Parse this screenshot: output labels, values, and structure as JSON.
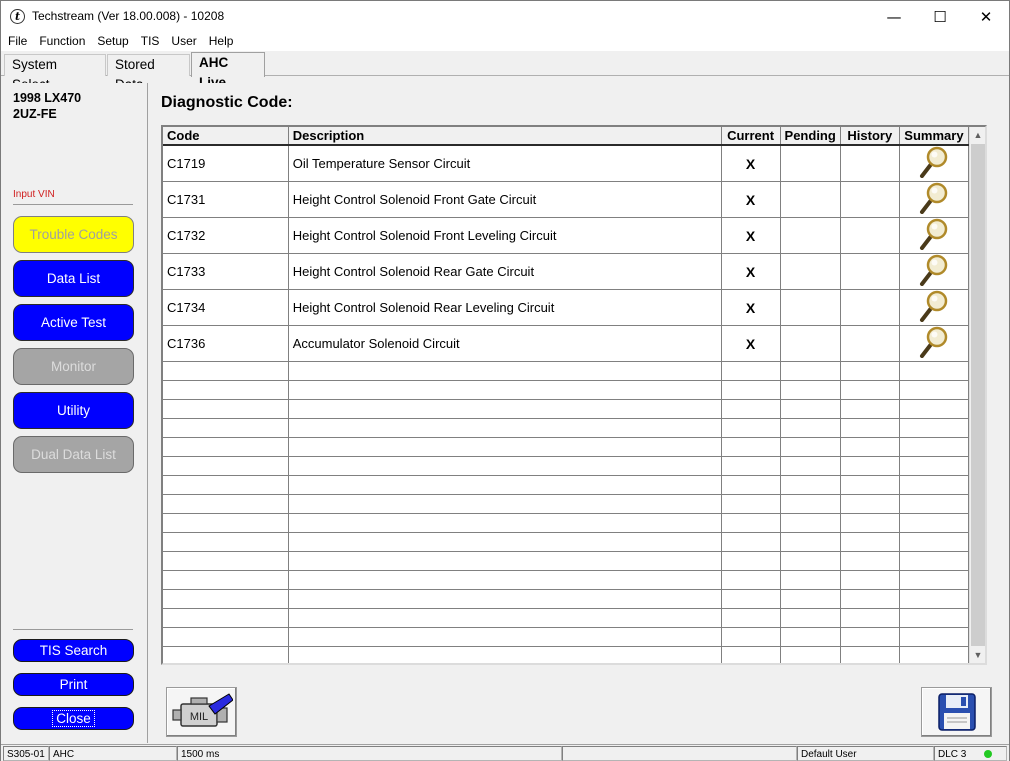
{
  "window": {
    "title": "Techstream (Ver 18.00.008) - 10208",
    "app_icon_glyph": "t",
    "minimize_glyph": "—",
    "maximize_glyph": "☐",
    "close_glyph": "✕"
  },
  "menu": [
    "File",
    "Function",
    "Setup",
    "TIS",
    "User",
    "Help"
  ],
  "tabs": [
    {
      "label": "System Select",
      "active": false
    },
    {
      "label": "Stored Data",
      "active": false
    },
    {
      "label": "AHC Live",
      "active": true
    }
  ],
  "sidebar": {
    "vehicle_line1": "1998 LX470",
    "vehicle_line2": "2UZ-FE",
    "input_vin_label": "Input VIN",
    "buttons": [
      {
        "label": "Trouble Codes",
        "style": "yellow"
      },
      {
        "label": "Data List",
        "style": "blue"
      },
      {
        "label": "Active Test",
        "style": "blue"
      },
      {
        "label": "Monitor",
        "style": "gray"
      },
      {
        "label": "Utility",
        "style": "blue"
      },
      {
        "label": "Dual Data List",
        "style": "gray"
      }
    ],
    "bottom_buttons": [
      {
        "label": "TIS Search"
      },
      {
        "label": "Print"
      },
      {
        "label": "Close"
      }
    ]
  },
  "main": {
    "title": "Diagnostic Code:",
    "columns": [
      "Code",
      "Description",
      "Current",
      "Pending",
      "History",
      "Summary"
    ],
    "rows": [
      {
        "code": "C1719",
        "description": "Oil Temperature Sensor Circuit",
        "current": "X",
        "pending": "",
        "history": "",
        "summary_icon": "magnifier-icon"
      },
      {
        "code": "C1731",
        "description": "Height Control Solenoid Front Gate Circuit",
        "current": "X",
        "pending": "",
        "history": "",
        "summary_icon": "magnifier-icon"
      },
      {
        "code": "C1732",
        "description": "Height Control Solenoid Front Leveling Circuit",
        "current": "X",
        "pending": "",
        "history": "",
        "summary_icon": "magnifier-icon"
      },
      {
        "code": "C1733",
        "description": "Height Control Solenoid Rear Gate Circuit",
        "current": "X",
        "pending": "",
        "history": "",
        "summary_icon": "magnifier-icon"
      },
      {
        "code": "C1734",
        "description": "Height Control Solenoid Rear Leveling Circuit",
        "current": "X",
        "pending": "",
        "history": "",
        "summary_icon": "magnifier-icon"
      },
      {
        "code": "C1736",
        "description": "Accumulator Solenoid Circuit",
        "current": "X",
        "pending": "",
        "history": "",
        "summary_icon": "magnifier-icon"
      }
    ],
    "engine_button_label": "MIL",
    "scroll_up_glyph": "▲",
    "scroll_down_glyph": "▼"
  },
  "statusbar": {
    "cells": [
      "S305-01",
      "AHC",
      "",
      "1500 ms",
      "",
      "Default User",
      "DLC 3"
    ],
    "connection_color": "#22c922"
  },
  "colors": {
    "button_blue": "#0000ff",
    "button_yellow": "#ffff00",
    "button_gray": "#a5a5a5",
    "vin_label": "#d02020"
  }
}
